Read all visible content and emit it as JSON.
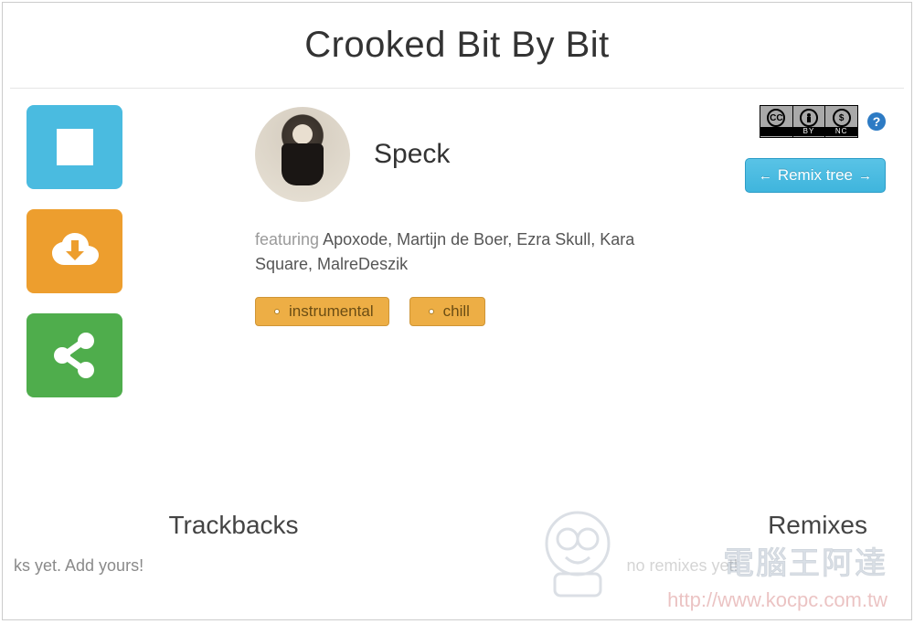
{
  "title": "Crooked Bit By Bit",
  "artist": {
    "name": "Speck"
  },
  "featuring": {
    "label": "featuring",
    "names": "Apoxode, Martijn de Boer, Ezra Skull, Kara Square, MalreDeszik"
  },
  "tags": [
    "instrumental",
    "chill"
  ],
  "license": {
    "cc": "CC",
    "by": "BY",
    "nc": "NC",
    "help_glyph": "?"
  },
  "remix_tree": {
    "left_arrow": "←",
    "label": "Remix tree",
    "right_arrow": "→"
  },
  "sections": {
    "trackbacks": {
      "heading": "Trackbacks",
      "empty": "ks yet. Add yours!"
    },
    "remixes": {
      "heading": "Remixes",
      "empty": "no remixes yet!"
    }
  },
  "watermark": {
    "name": "電腦王阿達",
    "url": "http://www.kocpc.com.tw"
  }
}
